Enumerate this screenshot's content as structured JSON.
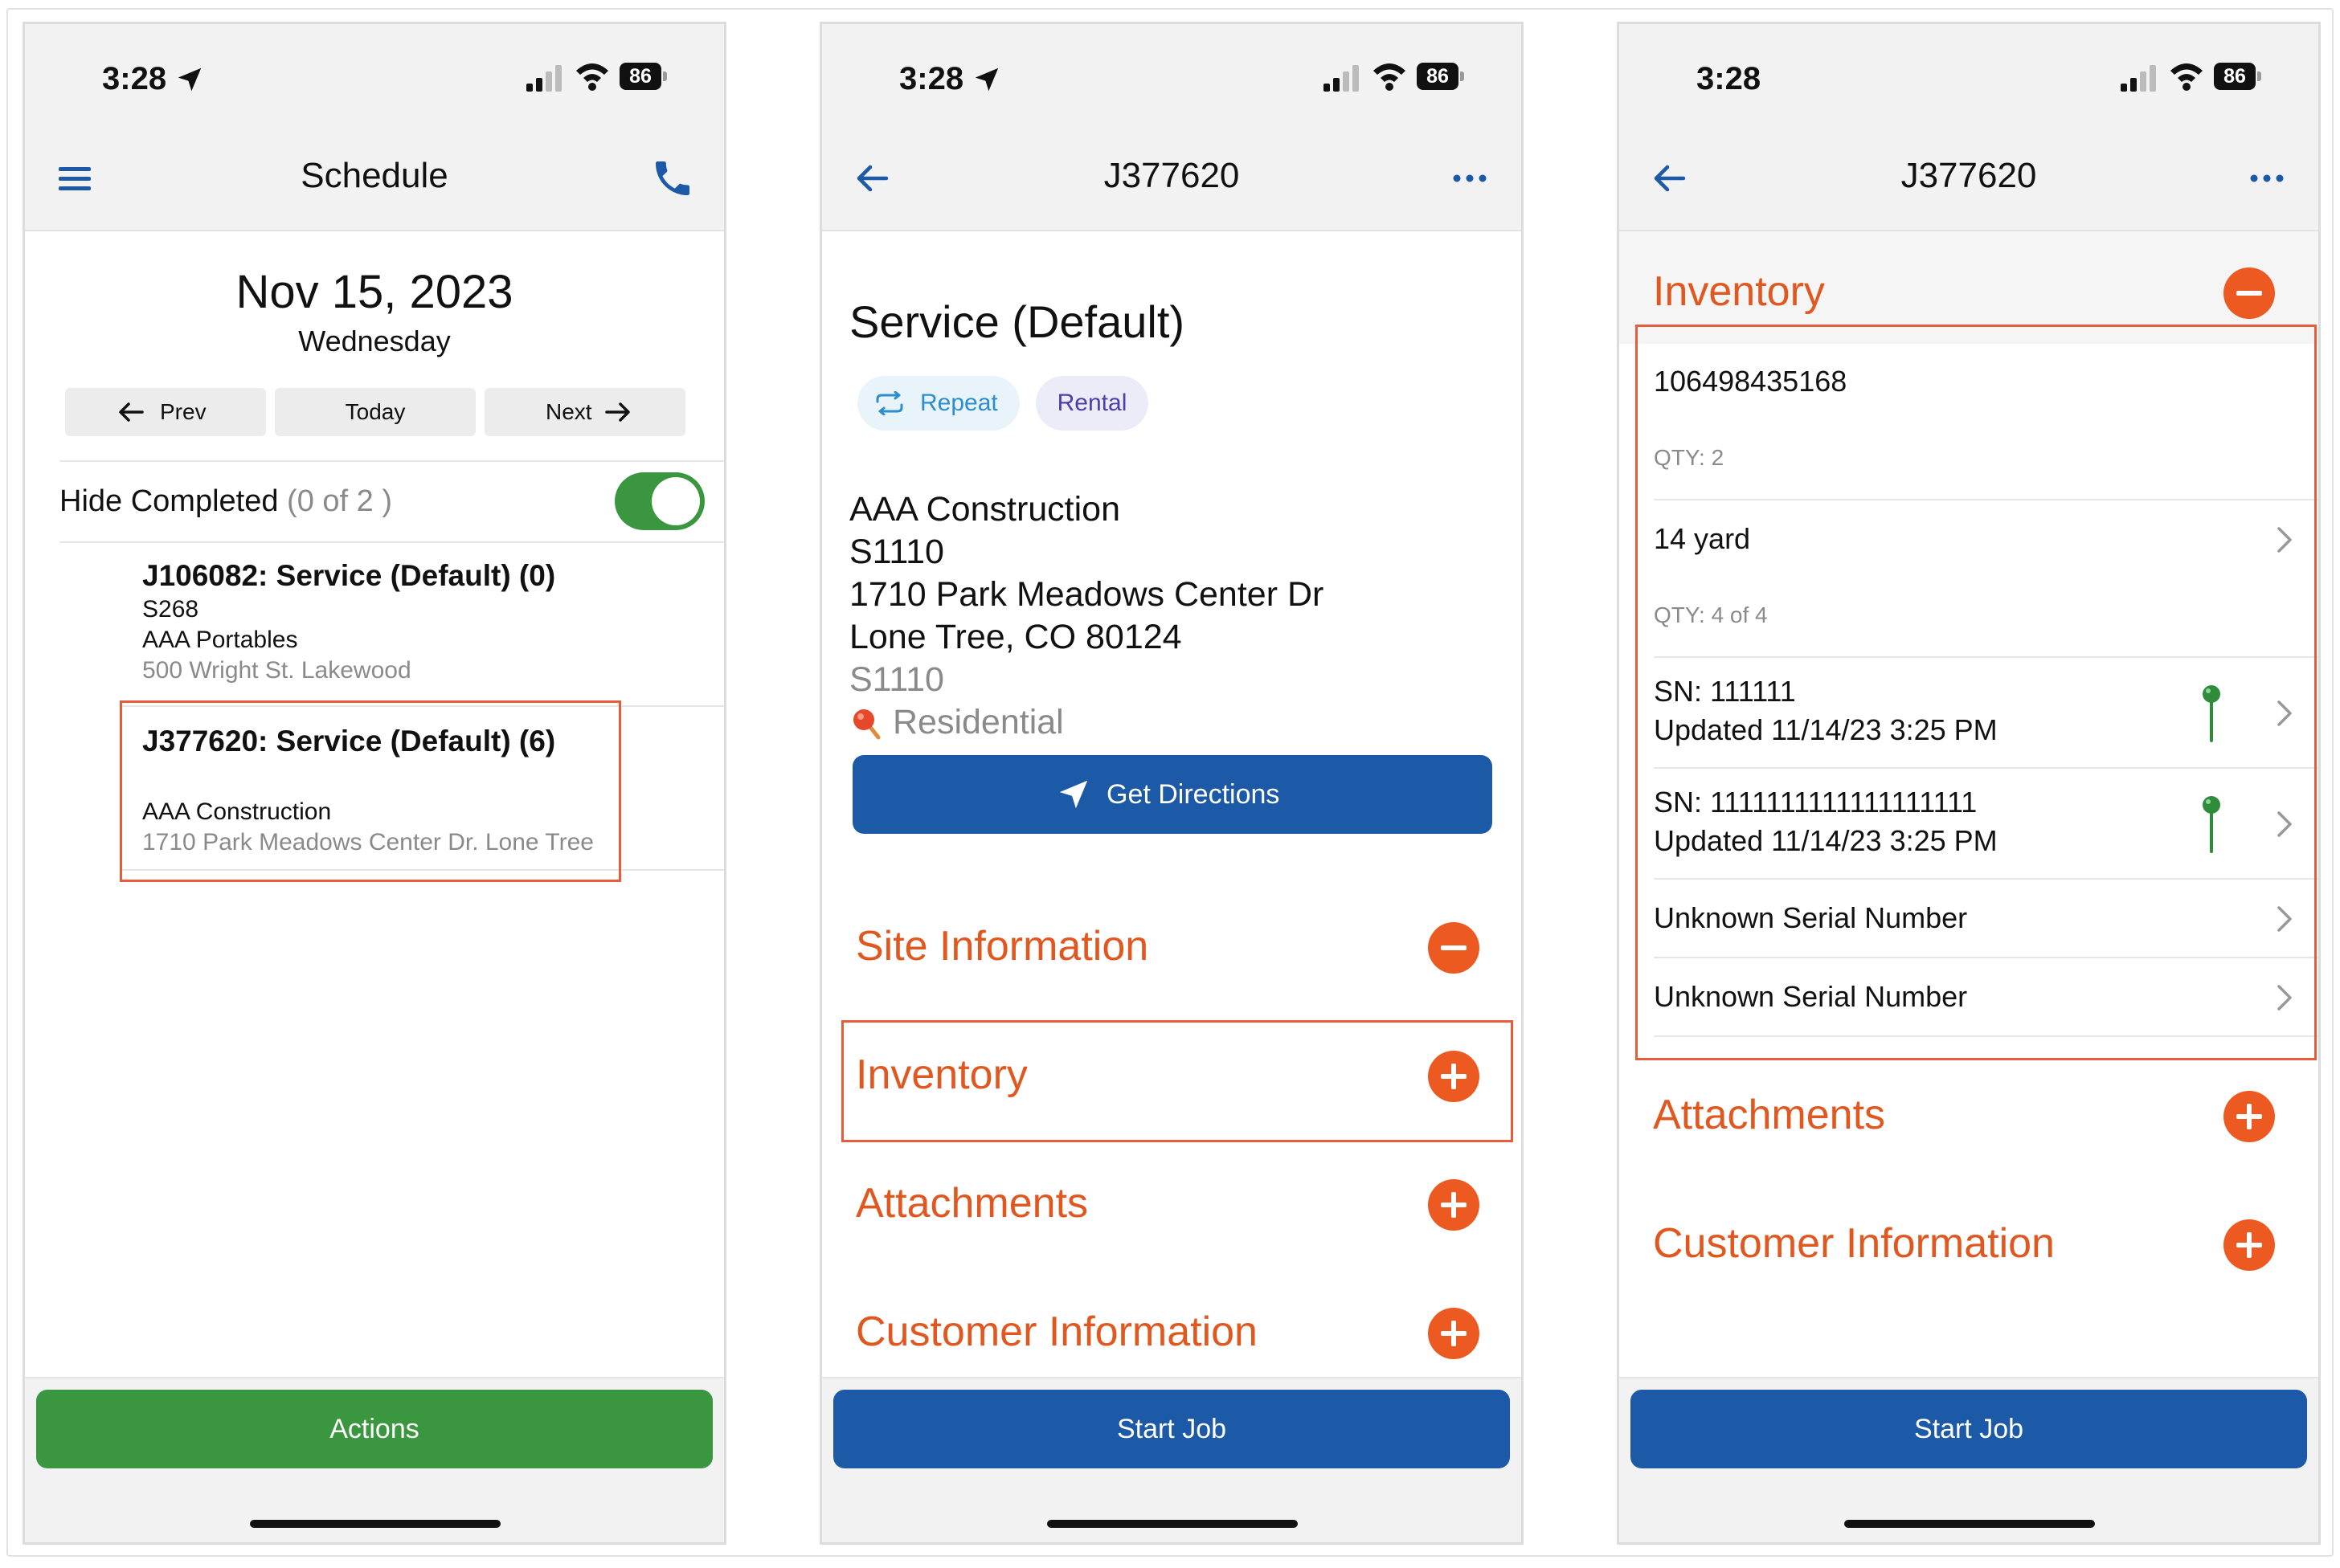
{
  "status_bar": {
    "time": "3:28",
    "battery": "86"
  },
  "screen1": {
    "title": "Schedule",
    "date": "Nov 15, 2023",
    "weekday": "Wednesday",
    "prev_label": "Prev",
    "today_label": "Today",
    "next_label": "Next",
    "hide_label": "Hide Completed",
    "hide_count": "(0 of 2 )",
    "jobs": [
      {
        "title": "J106082: Service (Default) (0)",
        "site": "S268",
        "customer": "AAA Portables",
        "address": "500 Wright St. Lakewood"
      },
      {
        "title": "J377620: Service (Default) (6)",
        "site": "",
        "customer": "AAA Construction",
        "address": "1710 Park Meadows Center Dr. Lone Tree"
      }
    ],
    "actions_label": "Actions"
  },
  "screen2": {
    "title": "J377620",
    "service_title": "Service (Default)",
    "chip_repeat": "Repeat",
    "chip_rental": "Rental",
    "customer": "AAA Construction",
    "site": "S1110",
    "street": "1710 Park Meadows Center Dr",
    "city": "Lone Tree, CO 80124",
    "site_gray": "S1110",
    "type": "Residential",
    "directions_label": "Get Directions",
    "sections": {
      "site_info": "Site Information",
      "inventory": "Inventory",
      "attachments": "Attachments",
      "customer_info": "Customer Information"
    },
    "start_label": "Start Job"
  },
  "screen3": {
    "title": "J377620",
    "inventory_header": "Inventory",
    "item_id": "106498435168",
    "item_qty": "QTY: 2",
    "size": "14 yard",
    "size_qty": "QTY: 4 of 4",
    "serials": [
      {
        "sn": "SN: 111111",
        "updated": "Updated 11/14/23 3:25 PM"
      },
      {
        "sn": "SN: 1111111111111111111",
        "updated": "Updated 11/14/23 3:25 PM"
      }
    ],
    "unknown1": "Unknown Serial Number",
    "unknown2": "Unknown Serial Number",
    "attachments": "Attachments",
    "customer_info": "Customer Information",
    "start_label": "Start Job"
  },
  "colors": {
    "accent_orange": "#ec5a22",
    "primary_blue": "#1c5aa8",
    "action_green": "#3a963f",
    "highlight_red": "#e55d3a"
  }
}
